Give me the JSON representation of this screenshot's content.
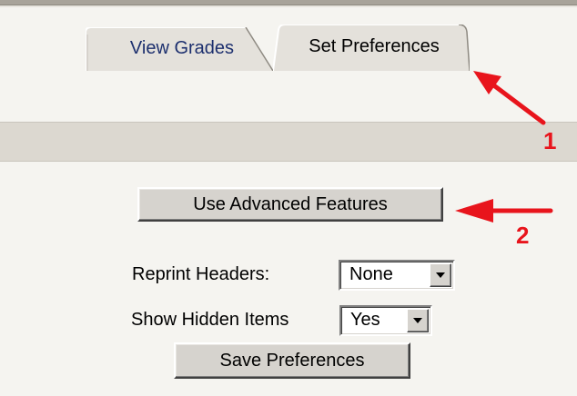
{
  "tabs": [
    {
      "label": "View Grades",
      "active": false
    },
    {
      "label": "Set Preferences",
      "active": true
    }
  ],
  "buttons": {
    "advanced_label": "Use Advanced Features",
    "save_label": "Save Preferences"
  },
  "form": {
    "reprint_headers": {
      "label": "Reprint Headers:",
      "value": "None"
    },
    "show_hidden_items": {
      "label": "Show Hidden Items",
      "value": "Yes"
    }
  },
  "annotations": {
    "step1": "1",
    "step2": "2",
    "color": "#e8141c"
  },
  "colors": {
    "background": "#f5f4f0",
    "band": "#dcd8d0",
    "tab_fill": "#e4e1db",
    "button_face": "#d6d3ce",
    "inactive_tab_text": "#1c2f6e"
  }
}
